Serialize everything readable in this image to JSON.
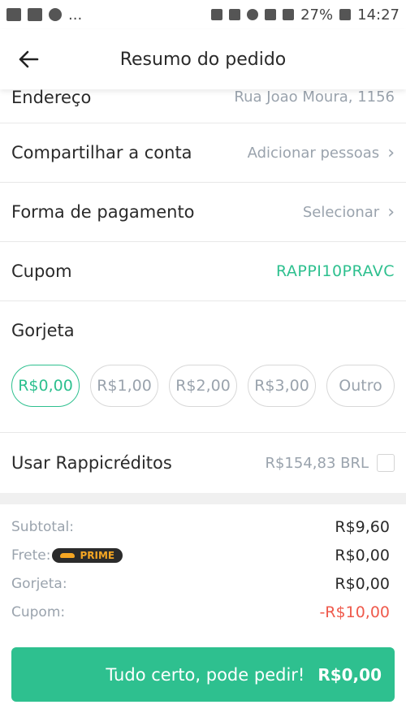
{
  "status_bar": {
    "dots": "...",
    "battery": "27%",
    "time": "14:27"
  },
  "header": {
    "title": "Resumo do pedido",
    "back_icon": "arrow-left-icon"
  },
  "rows": {
    "address": {
      "label": "Endereço",
      "value": "Rua Joao Moura, 1156"
    },
    "share": {
      "label": "Compartilhar a conta",
      "value": "Adicionar pessoas"
    },
    "payment": {
      "label": "Forma de pagamento",
      "value": "Selecionar"
    },
    "coupon": {
      "label": "Cupom",
      "value": "RAPPI10PRAVC"
    }
  },
  "tip": {
    "title": "Gorjeta",
    "options": [
      "R$0,00",
      "R$1,00",
      "R$2,00",
      "R$3,00",
      "Outro"
    ],
    "selected": "R$0,00"
  },
  "credits": {
    "label": "Usar Rappicréditos",
    "value": "R$154,83 BRL",
    "checked": false
  },
  "summary": {
    "subtotal_label": "Subtotal:",
    "subtotal_value": "R$9,60",
    "shipping_label": "Frete:",
    "prime_badge": "PRIME",
    "shipping_value": "R$0,00",
    "tip_label": "Gorjeta:",
    "tip_value": "R$0,00",
    "coupon_label": "Cupom:",
    "coupon_value": "-R$10,00"
  },
  "cta": {
    "label": "Tudo certo, pode pedir!",
    "value": "R$0,00"
  },
  "colors": {
    "accent": "#2ec08f",
    "negative": "#ef5a4c",
    "muted": "#9aa3ad"
  }
}
